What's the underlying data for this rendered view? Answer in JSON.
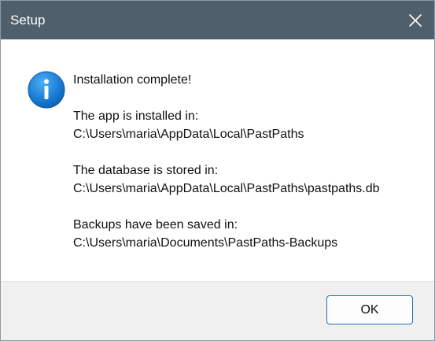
{
  "window": {
    "title": "Setup"
  },
  "dialog": {
    "icon": "info-icon",
    "heading": "Installation complete!",
    "app_label": "The app is installed in:",
    "app_path": "C:\\Users\\maria\\AppData\\Local\\PastPaths",
    "db_label": "The database is stored in:",
    "db_path": "C:\\Users\\maria\\AppData\\Local\\PastPaths\\pastpaths.db",
    "backup_label": "Backups have been saved in:",
    "backup_path": "C:\\Users\\maria\\Documents\\PastPaths-Backups"
  },
  "buttons": {
    "ok_label": "OK"
  },
  "colors": {
    "titlebar": "#4f5f6b",
    "accent": "#1f6fbf",
    "footer": "#f0f0f0"
  }
}
